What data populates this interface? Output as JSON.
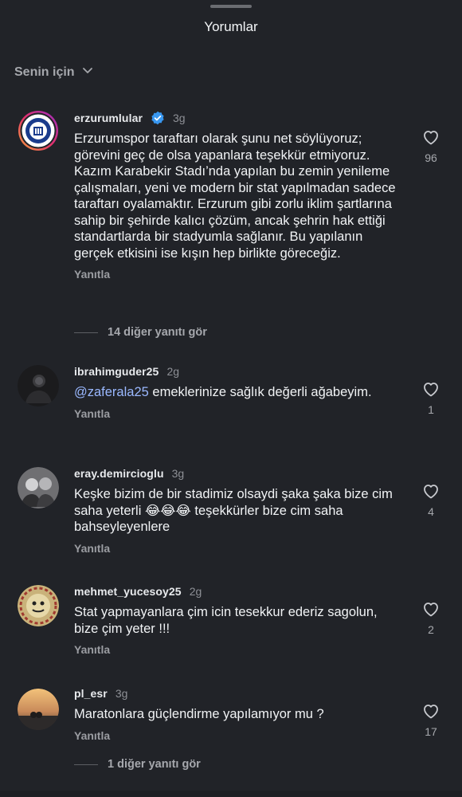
{
  "header": {
    "title": "Yorumlar"
  },
  "sort": {
    "label": "Senin için",
    "icon": "chevron-down-icon"
  },
  "comments": [
    {
      "user": "erzurumlular",
      "verified": true,
      "time": "3g",
      "text": "Erzurumspor taraftarı olarak şunu net söylüyoruz; görevini geç de olsa yapanlara teşekkür etmiyoruz. Kazım Karabekir Stadı’nda yapılan bu zemin yenileme çalışmaları, yeni ve modern bir stat yapılmadan sadece taraftarı oyalamaktır. Erzurum gibi zorlu iklim şartlarına sahip bir şehirde kalıcı çözüm, ancak şehrin hak ettiği standartlarda bir stadyumla sağlanır. Bu yapılanın gerçek etkisini ise kışın hep birlikte göreceğiz.",
      "reply": "Yanıtla",
      "likes": "96",
      "more_replies": "14 diğer yanıtı gör"
    },
    {
      "user": "ibrahimguder25",
      "time": "2g",
      "mention": "@zaferala25",
      "text": " emeklerinize sağlık değerli ağabeyim.",
      "reply": "Yanıtla",
      "likes": "1"
    },
    {
      "user": "eray.demircioglu",
      "time": "3g",
      "text": "Keşke bizim de bir stadimiz olsaydi şaka şaka bize cim saha yeterli 😂😂😂 teşekkürler bize cim saha bahseyleyenlere",
      "reply": "Yanıtla",
      "likes": "4"
    },
    {
      "user": "mehmet_yucesoy25",
      "time": "2g",
      "text": "Stat yapmayanlara çim icin tesekkur ederiz sagolun, bize çim yeter !!!",
      "reply": "Yanıtla",
      "likes": "2"
    },
    {
      "user": "pl_esr",
      "time": "3g",
      "text": "Maratonlara güçlendirme yapılamıyor mu ?",
      "reply": "Yanıtla",
      "likes": "17",
      "more_replies": "1 diğer yanıtı gör"
    }
  ],
  "colors": {
    "background": "#212328",
    "verified": "#3897f0",
    "mention": "#9ab8ff"
  }
}
